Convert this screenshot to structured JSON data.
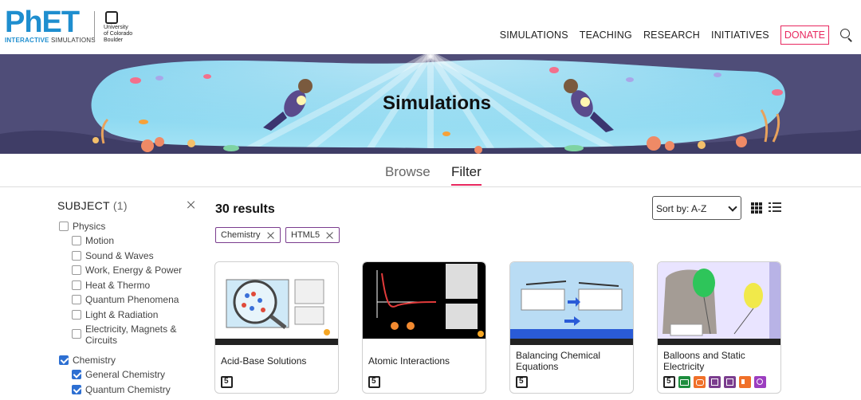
{
  "brand": {
    "logo_main": "PhET",
    "logo_sub_bold": "INTERACTIVE",
    "logo_sub_rest": "SIMULATIONS",
    "partner": "University\nof Colorado\nBoulder"
  },
  "nav": {
    "items": [
      "SIMULATIONS",
      "TEACHING",
      "RESEARCH",
      "INITIATIVES"
    ],
    "donate": "DONATE"
  },
  "banner": {
    "title": "Simulations"
  },
  "tabs": {
    "browse": "Browse",
    "filter": "Filter",
    "active": "Filter"
  },
  "filter": {
    "heading": "SUBJECT",
    "heading_count": "(1)",
    "items": [
      {
        "label": "Physics",
        "level": 0,
        "checked": false
      },
      {
        "label": "Motion",
        "level": 1,
        "checked": false
      },
      {
        "label": "Sound & Waves",
        "level": 1,
        "checked": false
      },
      {
        "label": "Work, Energy & Power",
        "level": 1,
        "checked": false
      },
      {
        "label": "Heat & Thermo",
        "level": 1,
        "checked": false
      },
      {
        "label": "Quantum Phenomena",
        "level": 1,
        "checked": false
      },
      {
        "label": "Light & Radiation",
        "level": 1,
        "checked": false
      },
      {
        "label": "Electricity, Magnets & Circuits",
        "level": 1,
        "checked": false
      },
      {
        "label": "Chemistry",
        "level": 0,
        "checked": true
      },
      {
        "label": "General Chemistry",
        "level": 1,
        "checked": true
      },
      {
        "label": "Quantum Chemistry",
        "level": 1,
        "checked": true
      }
    ]
  },
  "results": {
    "count_text": "30 results",
    "chips": [
      "Chemistry",
      "HTML5"
    ],
    "sort_label": "Sort by: A-Z",
    "cards": [
      {
        "title": "Acid-Base Solutions",
        "icons": [
          "html5-icon"
        ]
      },
      {
        "title": "Atomic Interactions",
        "icons": [
          "html5-icon"
        ]
      },
      {
        "title": "Balancing Chemical Equations",
        "icons": [
          "html5-icon"
        ]
      },
      {
        "title": "Balloons and Static Electricity",
        "icons": [
          "html5-icon",
          "keyboard-icon",
          "interactive-description-icon",
          "voicing-icon",
          "interactive-icon",
          "sound-icon",
          "zoom-icon"
        ]
      }
    ]
  },
  "colors": {
    "brand_blue": "#1e8ecf",
    "accent_pink": "#e8285f",
    "chip_border": "#7b3d8e",
    "checkbox_blue": "#2d6fd2"
  }
}
